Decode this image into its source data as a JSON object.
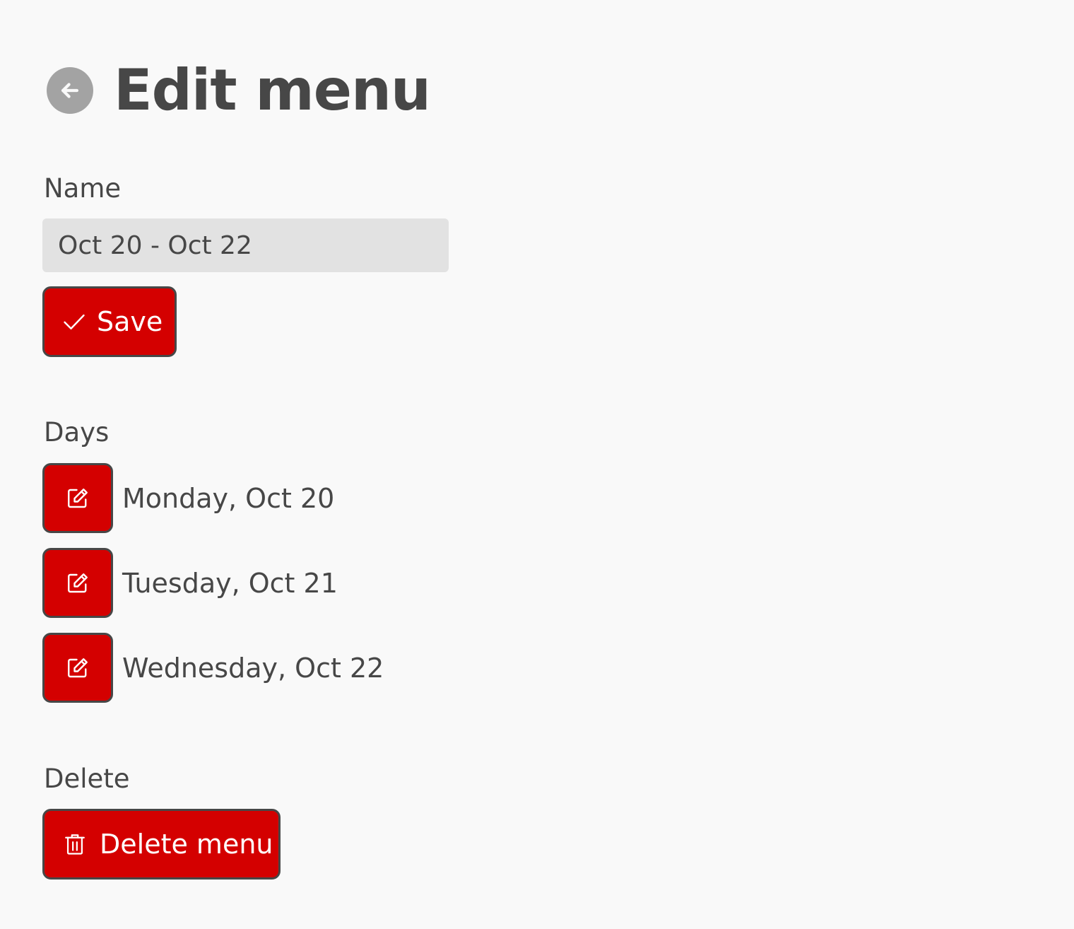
{
  "header": {
    "back_icon": "arrow-left-icon",
    "title": "Edit menu"
  },
  "name_section": {
    "label": "Name",
    "input_value": "Oct 20 - Oct 22",
    "save_icon": "check-icon",
    "save_label": "Save"
  },
  "days_section": {
    "label": "Days",
    "edit_icon": "edit-icon",
    "days": [
      {
        "label": "Monday, Oct 20"
      },
      {
        "label": "Tuesday, Oct 21"
      },
      {
        "label": "Wednesday, Oct 22"
      }
    ]
  },
  "delete_section": {
    "label": "Delete",
    "delete_icon": "trash-icon",
    "delete_label": "Delete menu"
  },
  "colors": {
    "accent": "#d40000",
    "text": "#474747",
    "background": "#f9f9f9",
    "input_background": "#e2e2e2",
    "back_button": "#a3a3a3"
  }
}
